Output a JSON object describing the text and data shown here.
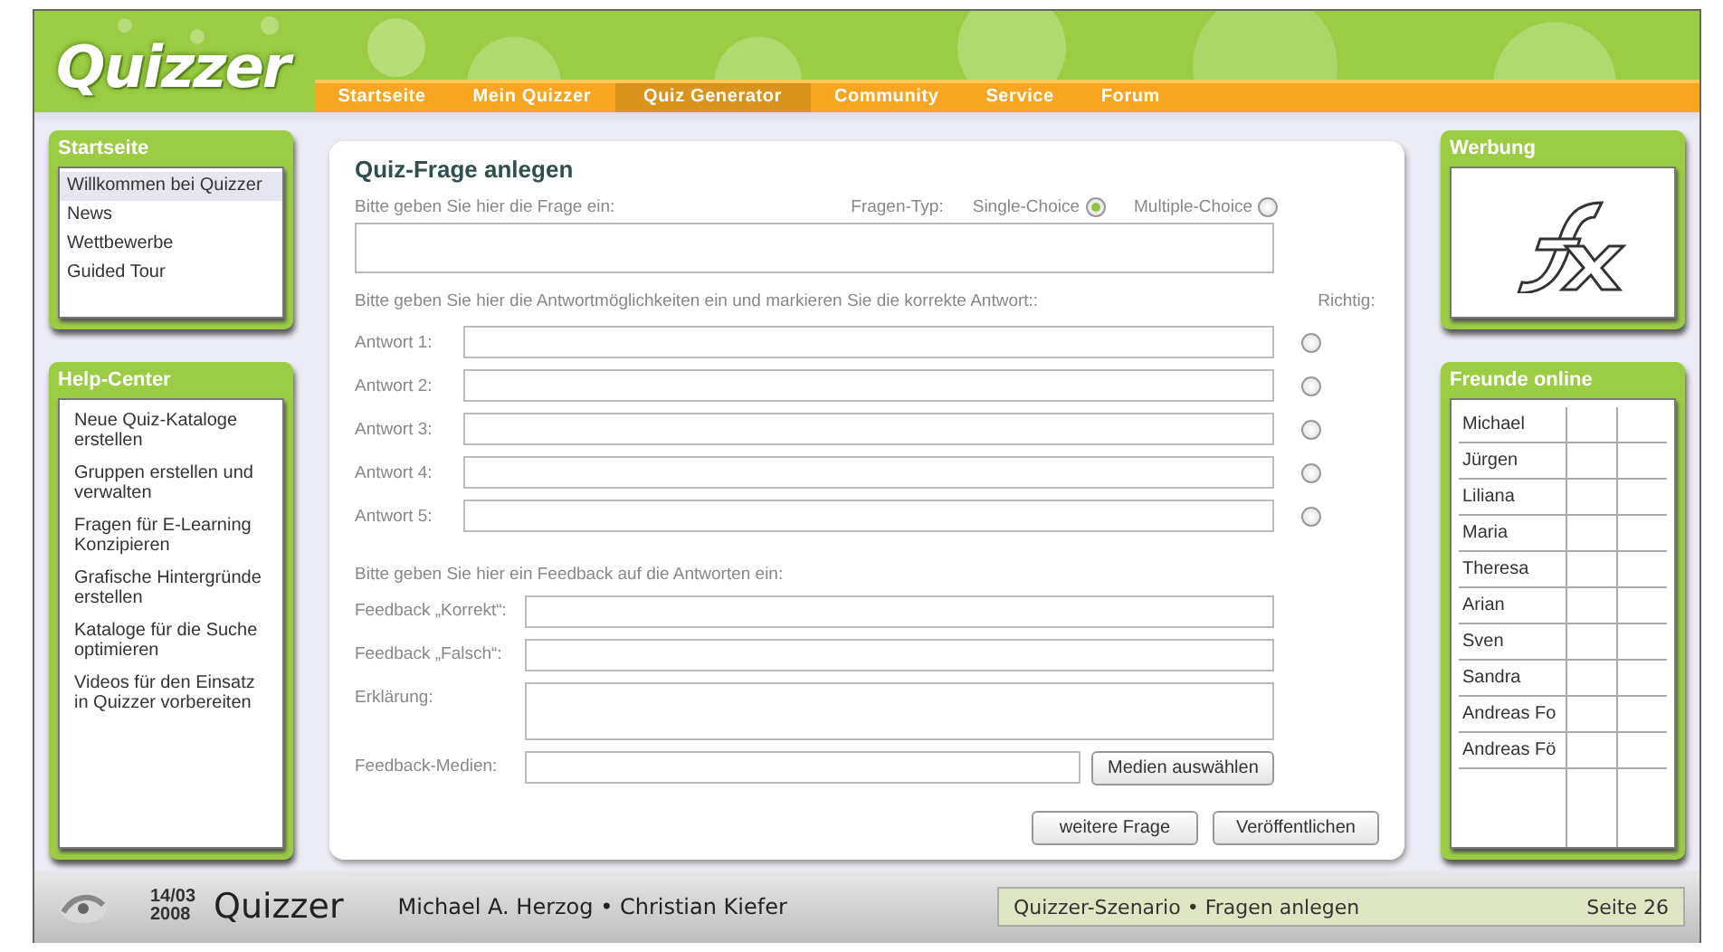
{
  "header": {
    "logo": "Quizzer",
    "nav": [
      {
        "label": "Startseite",
        "selected": false
      },
      {
        "label": "Mein Quizzer",
        "selected": false
      },
      {
        "label": "Quiz Generator",
        "selected": true
      },
      {
        "label": "Community",
        "selected": false
      },
      {
        "label": "Service",
        "selected": false
      },
      {
        "label": "Forum",
        "selected": false
      }
    ]
  },
  "left": {
    "start": {
      "title": "Startseite",
      "items": [
        {
          "label": "Willkommen bei Quizzer",
          "selected": true
        },
        {
          "label": "News",
          "selected": false
        },
        {
          "label": "Wettbewerbe",
          "selected": false
        },
        {
          "label": "Guided Tour",
          "selected": false
        }
      ]
    },
    "help": {
      "title": "Help-Center",
      "items": [
        "Neue Quiz-Kataloge erstellen",
        "Gruppen erstellen und verwalten",
        "Fragen für E-Learning Konzipieren",
        "Grafische Hintergründe erstellen",
        "Kataloge für die Suche optimieren",
        "Videos für den Einsatz in Quizzer vorbereiten"
      ]
    }
  },
  "form": {
    "title": "Quiz-Frage anlegen",
    "question_prompt": "Bitte geben Sie hier die Frage ein:",
    "type_label": "Fragen-Typ:",
    "types": [
      {
        "label": "Single-Choice",
        "selected": true
      },
      {
        "label": "Multiple-Choice",
        "selected": false
      }
    ],
    "answers_prompt": "Bitte geben Sie hier die Antwortmöglichkeiten ein und markieren Sie die korrekte Antwort::",
    "correct_label": "Richtig:",
    "answers": [
      {
        "label": "Antwort 1:",
        "selected": false
      },
      {
        "label": "Antwort 2:",
        "selected": false
      },
      {
        "label": "Antwort 3:",
        "selected": false
      },
      {
        "label": "Antwort 4:",
        "selected": false
      },
      {
        "label": "Antwort 5:",
        "selected": false
      }
    ],
    "feedback_prompt": "Bitte geben Sie hier ein Feedback auf die Antworten ein:",
    "feedback_fields": [
      {
        "label": "Feedback „Korrekt“:",
        "kind": "line"
      },
      {
        "label": "Feedback „Falsch“:",
        "kind": "line"
      },
      {
        "label": "Erklärung:",
        "kind": "area"
      }
    ],
    "media_label": "Feedback-Medien:",
    "media_button": "Medien auswählen",
    "buttons": [
      "weitere Frage",
      "Veröffentlichen"
    ]
  },
  "right": {
    "ad_title": "Werbung",
    "friends_title": "Freunde online",
    "friends": [
      "Michael",
      "Jürgen",
      "Liliana",
      "Maria",
      "Theresa",
      "Arian",
      "Sven",
      "Sandra",
      "Andreas Fo",
      "Andreas Fö"
    ]
  },
  "footer": {
    "day": "14/03",
    "year": "2008",
    "brand": "Quizzer",
    "authors": "Michael A. Herzog • Christian Kiefer",
    "topic": "Quizzer-Szenario • Fragen anlegen",
    "page": "Seite 26"
  }
}
